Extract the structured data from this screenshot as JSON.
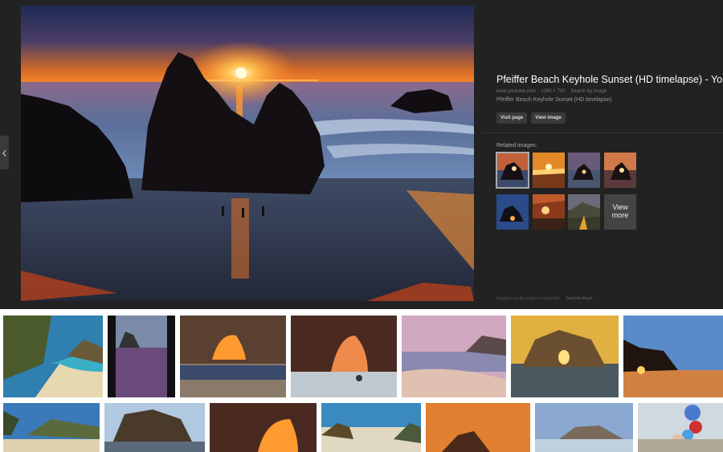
{
  "detail": {
    "prev_icon": "chevron-left-icon",
    "prev_glyph": "‹",
    "title": "Pfeiffer Beach Keyhole Sunset (HD timelapse) - YouTube",
    "source": "www.youtube.com",
    "dimensions": "1280 × 720",
    "search_by_image": "Search by image",
    "description": "Pfeiffer Beach Keyhole Sunset (HD timelapse)",
    "visit_label": "Visit page",
    "view_label": "View image",
    "related_label": "Related images:",
    "view_more_label": "View more",
    "copyright_note": "Images may be subject to copyright.",
    "send_feedback": "Send feedback"
  }
}
